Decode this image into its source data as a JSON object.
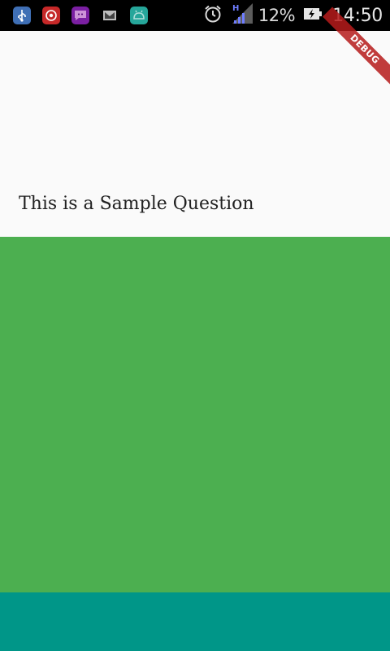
{
  "status_bar": {
    "notifications": [
      {
        "icon": "usb-icon",
        "color": "#3f6fb5"
      },
      {
        "icon": "screen-recorder-icon",
        "color": "#c62828"
      },
      {
        "icon": "messenger-icon",
        "color": "#7b1fa2"
      },
      {
        "icon": "gmail-icon",
        "color": "#9e9e9e"
      },
      {
        "icon": "android-debug-icon",
        "color": "#26a69a"
      }
    ],
    "network_type": "H",
    "battery_percent": "12%",
    "time": "14:50"
  },
  "debug_banner": {
    "label": "DEBUG",
    "color": "#b71c1c"
  },
  "question": {
    "text": "This is a Sample Question"
  },
  "colors": {
    "background": "#fafafa",
    "answer_area": "#4caf50",
    "bottom_bar": "#009688"
  }
}
